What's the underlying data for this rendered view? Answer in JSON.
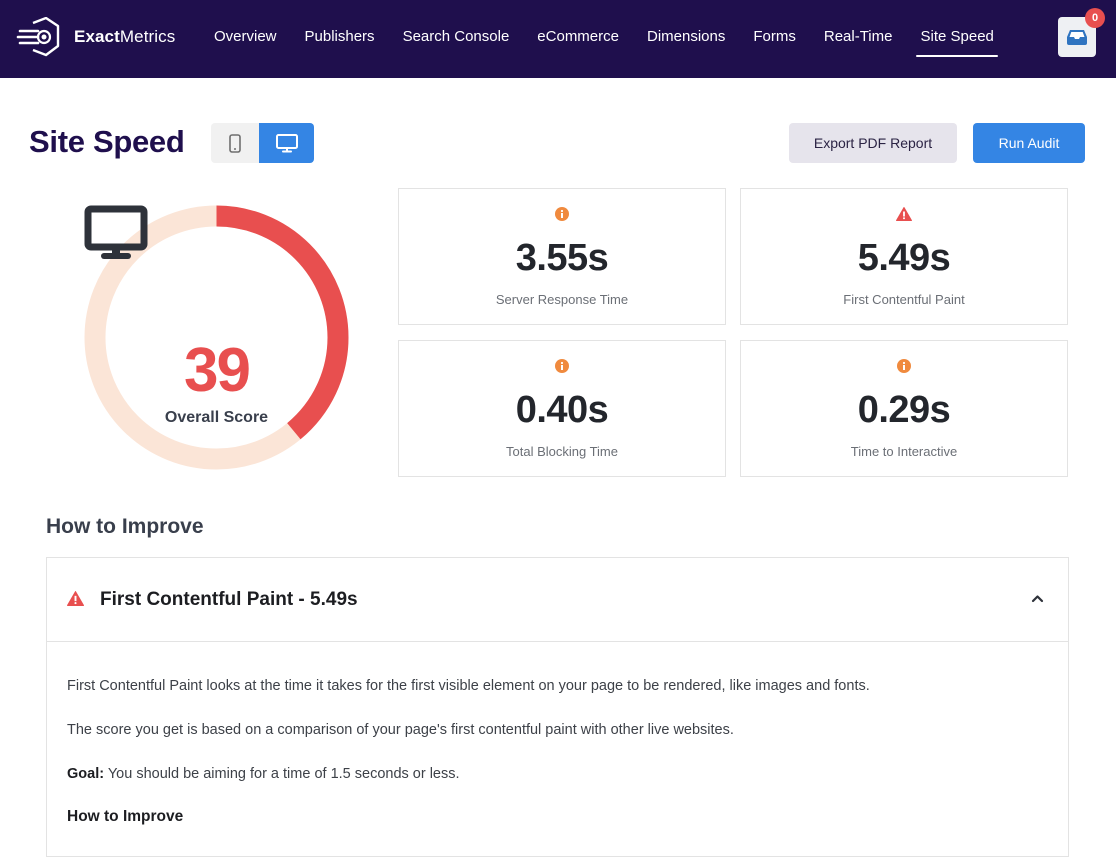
{
  "brand": {
    "bold": "Exact",
    "regular": "Metrics"
  },
  "nav": {
    "items": [
      {
        "label": "Overview"
      },
      {
        "label": "Publishers"
      },
      {
        "label": "Search Console"
      },
      {
        "label": "eCommerce"
      },
      {
        "label": "Dimensions"
      },
      {
        "label": "Forms"
      },
      {
        "label": "Real-Time"
      },
      {
        "label": "Site Speed",
        "active": true
      }
    ],
    "inbox_icon": "inbox-tray-icon",
    "notification_count": "0"
  },
  "header": {
    "title": "Site Speed",
    "device_toggle": {
      "options": [
        "mobile",
        "desktop"
      ],
      "selected": "desktop"
    },
    "export_label": "Export PDF Report",
    "run_label": "Run Audit"
  },
  "score": {
    "value": "39",
    "value_pct": 39,
    "label": "Overall Score",
    "icon": "desktop-monitor-icon",
    "colors": {
      "fill": "#e84f4f",
      "track": "#fbe5d7"
    }
  },
  "metrics": [
    {
      "value": "3.55s",
      "label": "Server Response Time",
      "status": "info",
      "icon": "info-circle-icon"
    },
    {
      "value": "5.49s",
      "label": "First Contentful Paint",
      "status": "warning",
      "icon": "warning-triangle-icon"
    },
    {
      "value": "0.40s",
      "label": "Total Blocking Time",
      "status": "info",
      "icon": "info-circle-icon"
    },
    {
      "value": "0.29s",
      "label": "Time to Interactive",
      "status": "info",
      "icon": "info-circle-icon"
    }
  ],
  "colors": {
    "info": "#f08a3e",
    "warning": "#e84f4f",
    "accent": "#3485e4",
    "nav_bg": "#1f0f4d"
  },
  "improve": {
    "title": "How to Improve",
    "items": [
      {
        "title": "First Contentful Paint - 5.49s",
        "expanded": true,
        "paragraphs": [
          "First Contentful Paint looks at the time it takes for the first visible element on your page to be rendered, like images and fonts.",
          "The score you get is based on a comparison of your page's first contentful paint with other live websites."
        ],
        "goal_label": "Goal:",
        "goal_text": " You should be aiming for a time of 1.5 seconds or less.",
        "subheading": "How to Improve"
      }
    ]
  }
}
